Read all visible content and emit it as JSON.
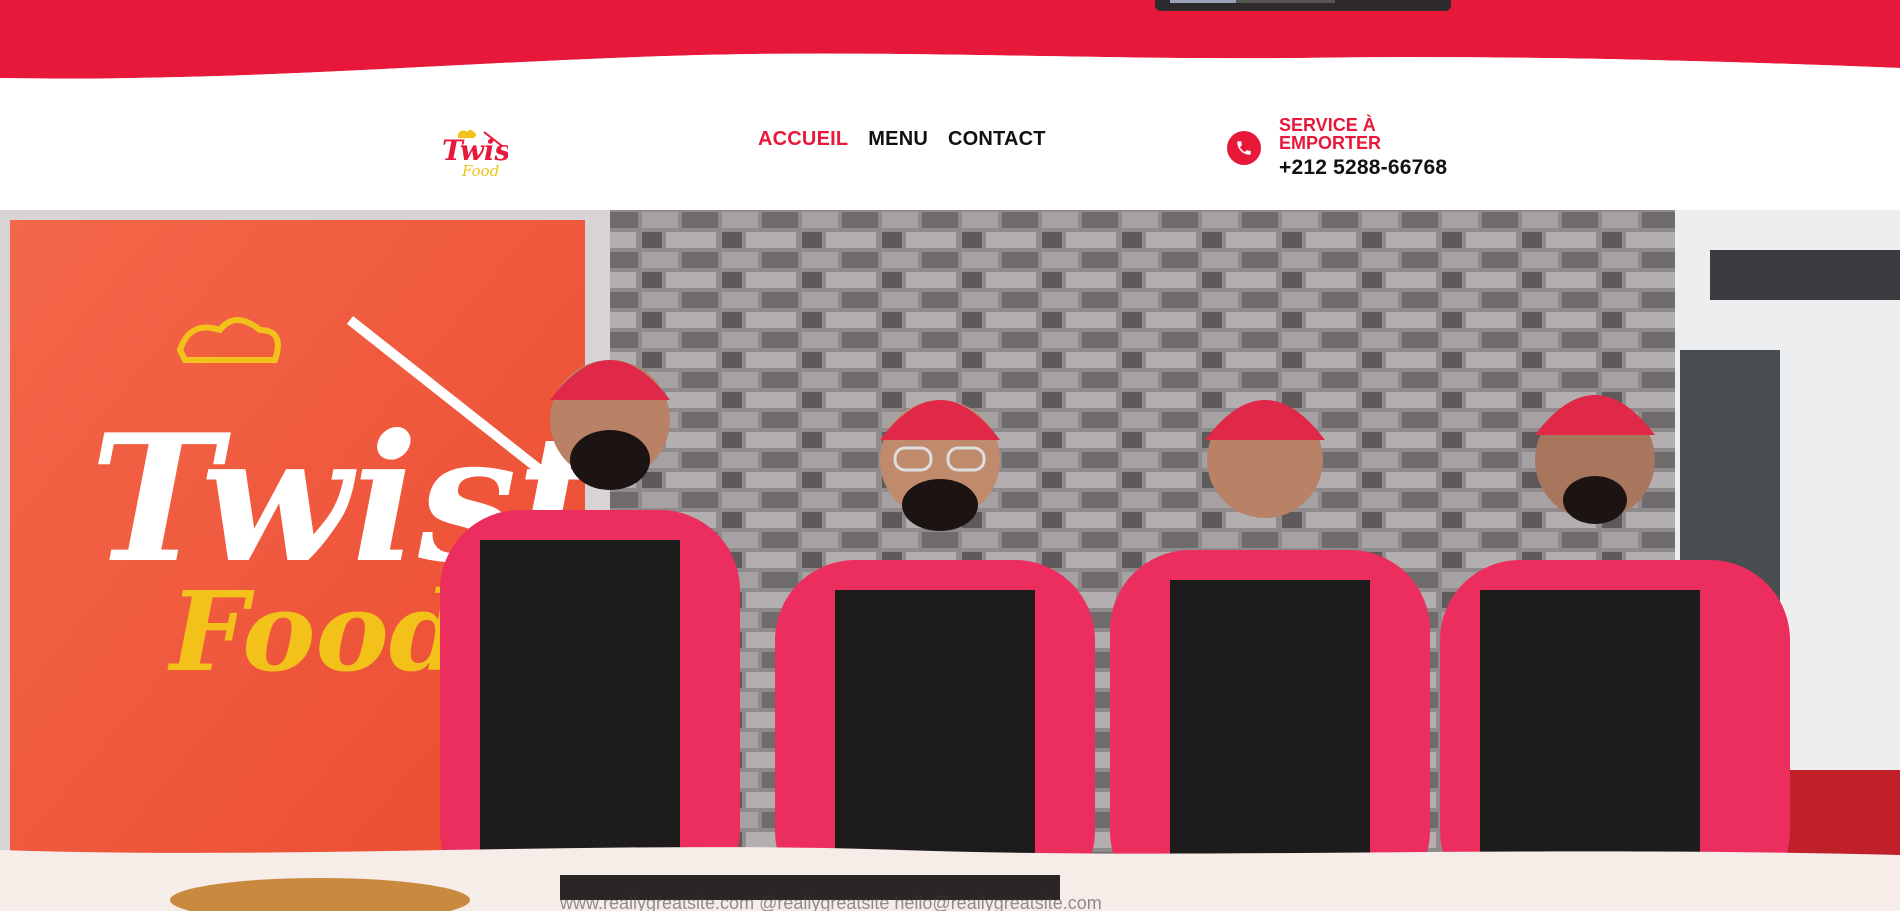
{
  "colors": {
    "brand_red": "#e8183a",
    "text_dark": "#111111",
    "white": "#ffffff",
    "hero_orange": "#f0553a"
  },
  "top_overlay": {
    "progress_fraction": 0.4
  },
  "header": {
    "logo_alt": "Twist Food",
    "nav": [
      {
        "label": "ACCUEIL",
        "active": true
      },
      {
        "label": "MENU",
        "active": false
      },
      {
        "label": "CONTACT",
        "active": false
      }
    ],
    "contact": {
      "icon": "phone-icon",
      "service_label": "SERVICE À EMPORTER",
      "phone": "+212 5288-66768"
    }
  },
  "hero": {
    "sign_brand_line1": "Twist",
    "sign_brand_line2": "Food",
    "watermark": "www.reallygreatsite.com   @reallygreatsite   hello@reallygreatsite.com",
    "staff_count": 4
  }
}
